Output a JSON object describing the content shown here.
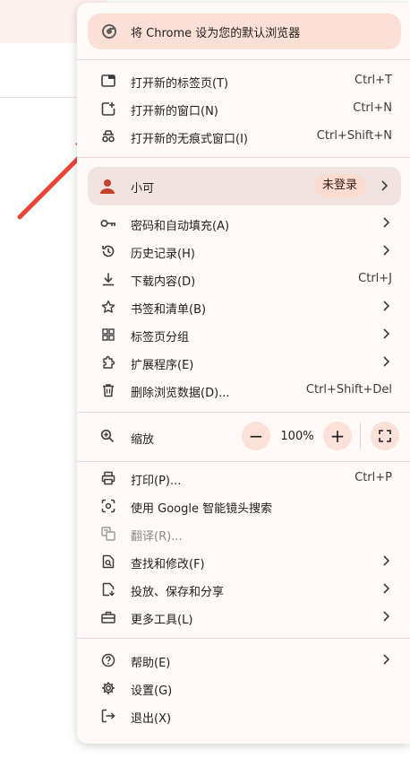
{
  "banner": {
    "label": "将 Chrome 设为您的默认浏览器",
    "icon": "chrome-icon"
  },
  "group1": [
    {
      "id": "new-tab",
      "label": "打开新的标签页(T)",
      "shortcut": "Ctrl+T",
      "icon": "new-tab-icon"
    },
    {
      "id": "new-window",
      "label": "打开新的窗口(N)",
      "shortcut": "Ctrl+N",
      "icon": "new-window-icon"
    },
    {
      "id": "incognito",
      "label": "打开新的无痕式窗口(I)",
      "shortcut": "Ctrl+Shift+N",
      "icon": "incognito-icon"
    }
  ],
  "profile": {
    "name": "小可",
    "status": "未登录",
    "icon": "person-icon"
  },
  "group2": [
    {
      "id": "passwords",
      "label": "密码和自动填充(A)",
      "icon": "key-icon"
    },
    {
      "id": "history",
      "label": "历史记录(H)",
      "icon": "history-icon"
    },
    {
      "id": "downloads",
      "label": "下载内容(D)",
      "shortcut": "Ctrl+J",
      "icon": "download-icon"
    },
    {
      "id": "bookmarks",
      "label": "书签和清单(B)",
      "icon": "star-icon"
    },
    {
      "id": "tab-groups",
      "label": "标签页分组",
      "icon": "tab-groups-icon"
    },
    {
      "id": "extensions",
      "label": "扩展程序(E)",
      "icon": "puzzle-icon"
    },
    {
      "id": "clear-data",
      "label": "删除浏览数据(D)...",
      "shortcut": "Ctrl+Shift+Del",
      "icon": "trash-icon"
    }
  ],
  "zoom": {
    "label": "缩放",
    "value": "100%",
    "minus": "−",
    "plus": "+",
    "icon": "zoom-icon"
  },
  "group3": [
    {
      "id": "print",
      "label": "打印(P)...",
      "shortcut": "Ctrl+P",
      "icon": "print-icon"
    },
    {
      "id": "lens",
      "label": "使用 Google 智能镜头搜索",
      "icon": "lens-icon"
    },
    {
      "id": "translate",
      "label": "翻译(R)...",
      "icon": "translate-icon",
      "disabled": true
    },
    {
      "id": "find",
      "label": "查找和修改(F)",
      "icon": "find-icon"
    },
    {
      "id": "cast",
      "label": "投放、保存和分享",
      "icon": "cast-save-icon"
    },
    {
      "id": "more-tools",
      "label": "更多工具(L)",
      "icon": "toolbox-icon"
    }
  ],
  "group4": [
    {
      "id": "help",
      "label": "帮助(E)",
      "icon": "help-icon"
    },
    {
      "id": "settings",
      "label": "设置(G)",
      "icon": "gear-icon"
    },
    {
      "id": "exit",
      "label": "退出(X)",
      "icon": "exit-icon"
    }
  ],
  "colors": {
    "accent": "#c5432a",
    "banner_bg": "#fde0d5",
    "menu_bg": "#fff9f8",
    "arrow": "#e8453c"
  }
}
